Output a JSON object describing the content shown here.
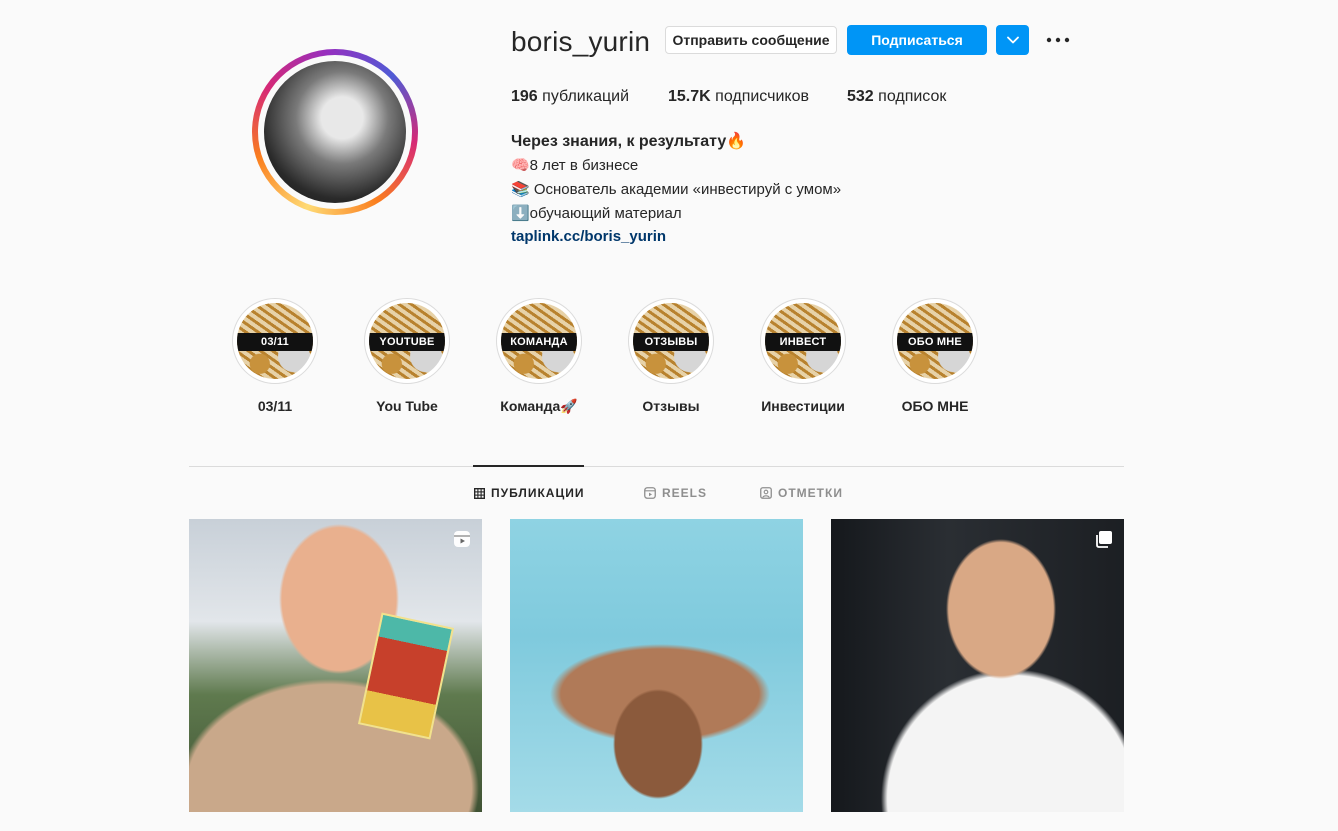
{
  "profile": {
    "username": "boris_yurin",
    "message_button": "Отправить сообщение",
    "follow_button": "Подписаться",
    "stats": {
      "posts_count": "196",
      "posts_label": "публикаций",
      "followers_count": "15.7K",
      "followers_label": "подписчиков",
      "following_count": "532",
      "following_label": "подписок"
    },
    "bio": {
      "name_line": "Через знания, к результату🔥",
      "line1": "🧠8 лет в бизнесе",
      "line2": "📚 Основатель академии «инвестируй с умом»",
      "line3": "⬇️обучающий материал",
      "link": "taplink.cc/boris_yurin"
    }
  },
  "highlights": [
    {
      "cover_text": "03/11",
      "label": "03/11"
    },
    {
      "cover_text": "YOUTUBE",
      "label": "You Tube"
    },
    {
      "cover_text": "КОМАНДА",
      "label": "Команда🚀"
    },
    {
      "cover_text": "ОТЗЫВЫ",
      "label": "Отзывы"
    },
    {
      "cover_text": "ИНВЕСТ",
      "label": "Инвестиции"
    },
    {
      "cover_text": "ОБО МНЕ",
      "label": "ОБО МНЕ"
    }
  ],
  "tabs": {
    "posts": "ПУБЛИКАЦИИ",
    "reels": "REELS",
    "tagged": "ОТМЕТКИ",
    "active": "posts"
  },
  "posts": [
    {
      "type": "reel",
      "icon": "reel-icon"
    },
    {
      "type": "photo",
      "icon": ""
    },
    {
      "type": "carousel",
      "icon": "carousel-icon"
    }
  ],
  "colors": {
    "accent": "#0095f6",
    "link": "#00376b",
    "text": "#262626",
    "muted": "#8e8e8e",
    "background": "#fafafa"
  }
}
